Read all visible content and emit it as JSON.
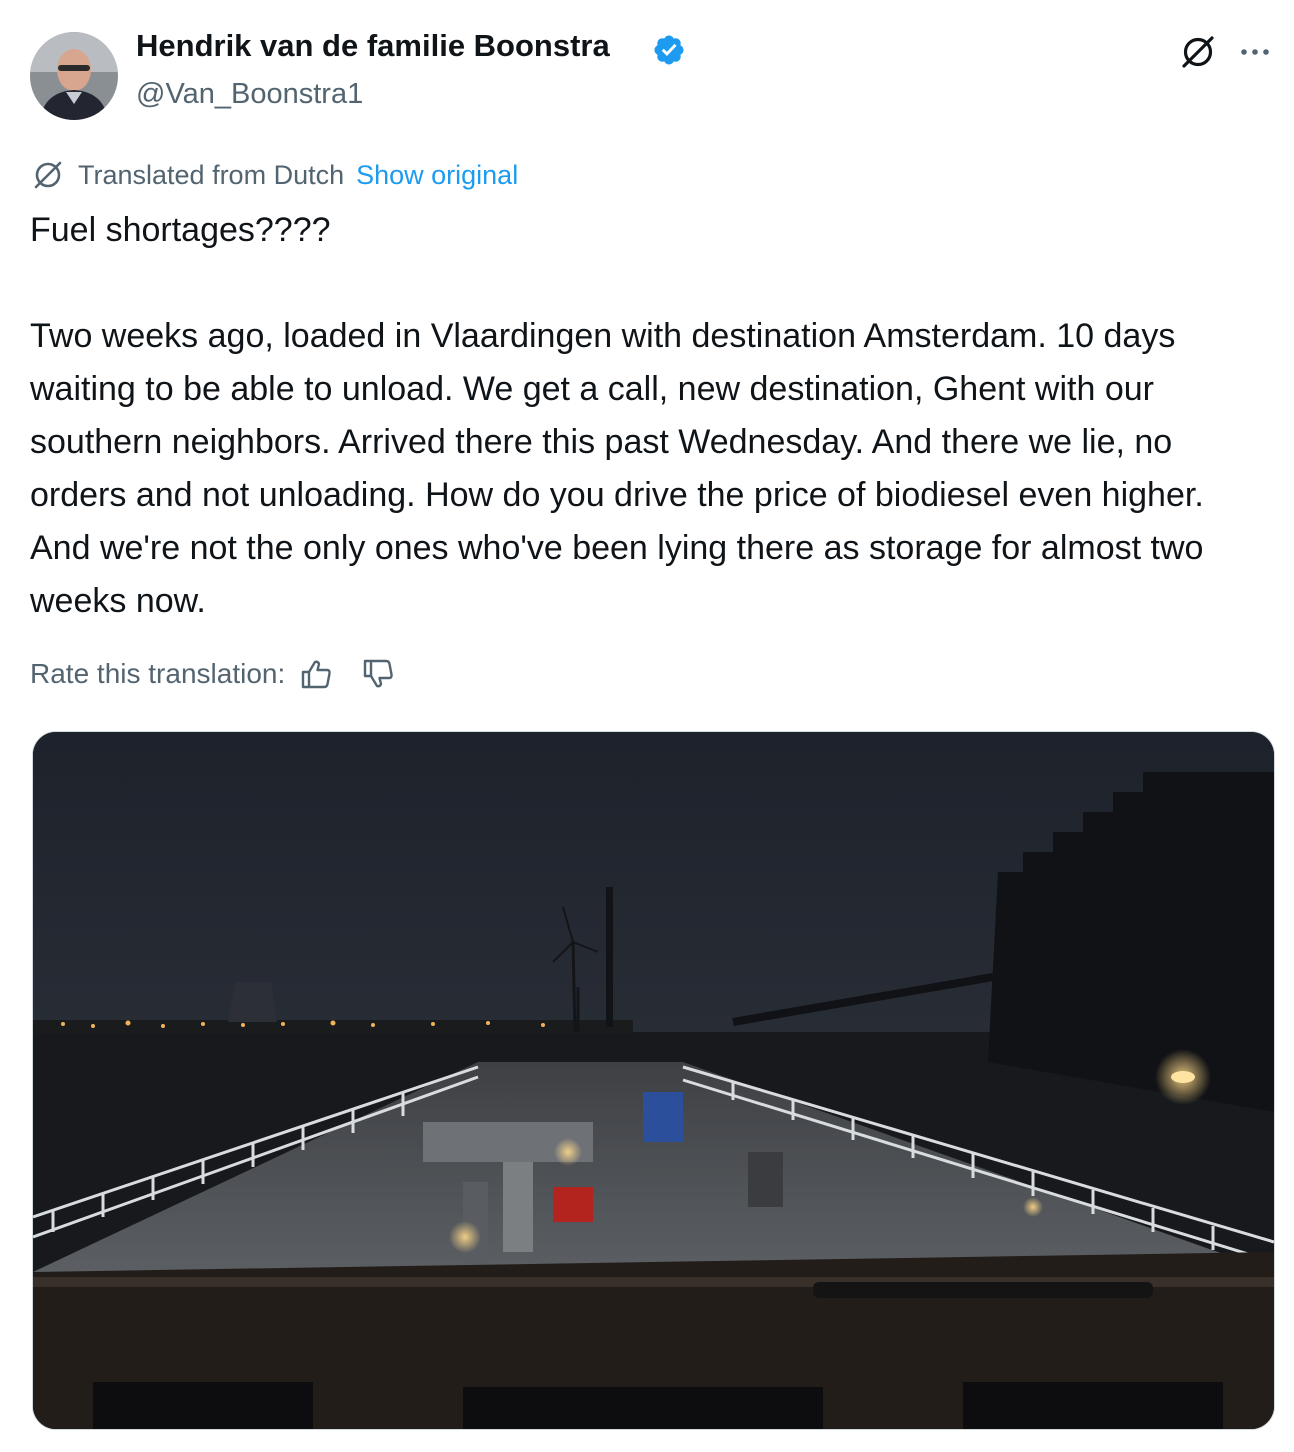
{
  "tweet": {
    "author_name": "Hendrik van de familie Boonstra",
    "handle": "@Van_Boonstra1",
    "verified_icon": "verified-badge-icon",
    "translated_label": "Translated from Dutch",
    "show_original_label": "Show original",
    "text_line1": "Fuel shortages????",
    "text_paragraph": "Two weeks ago, loaded in Vlaardingen with destination Amsterdam. 10 days waiting to be able to unload. We get a call, new destination, Ghent with our southern neighbors. Arrived there this past Wednesday. And there we lie, no orders and not unloading. How do you drive the price of biodiesel even higher. And we're not the only ones who've been lying there as storage for almost two weeks now.",
    "rate_label": "Rate this translation:"
  },
  "colors": {
    "accent": "#1d9bf0",
    "secondary_text": "#536471",
    "primary_text": "#0f1419"
  },
  "icons": [
    "grok-icon",
    "more-icon",
    "translate-icon",
    "thumbs-up-icon",
    "thumbs-down-icon"
  ]
}
